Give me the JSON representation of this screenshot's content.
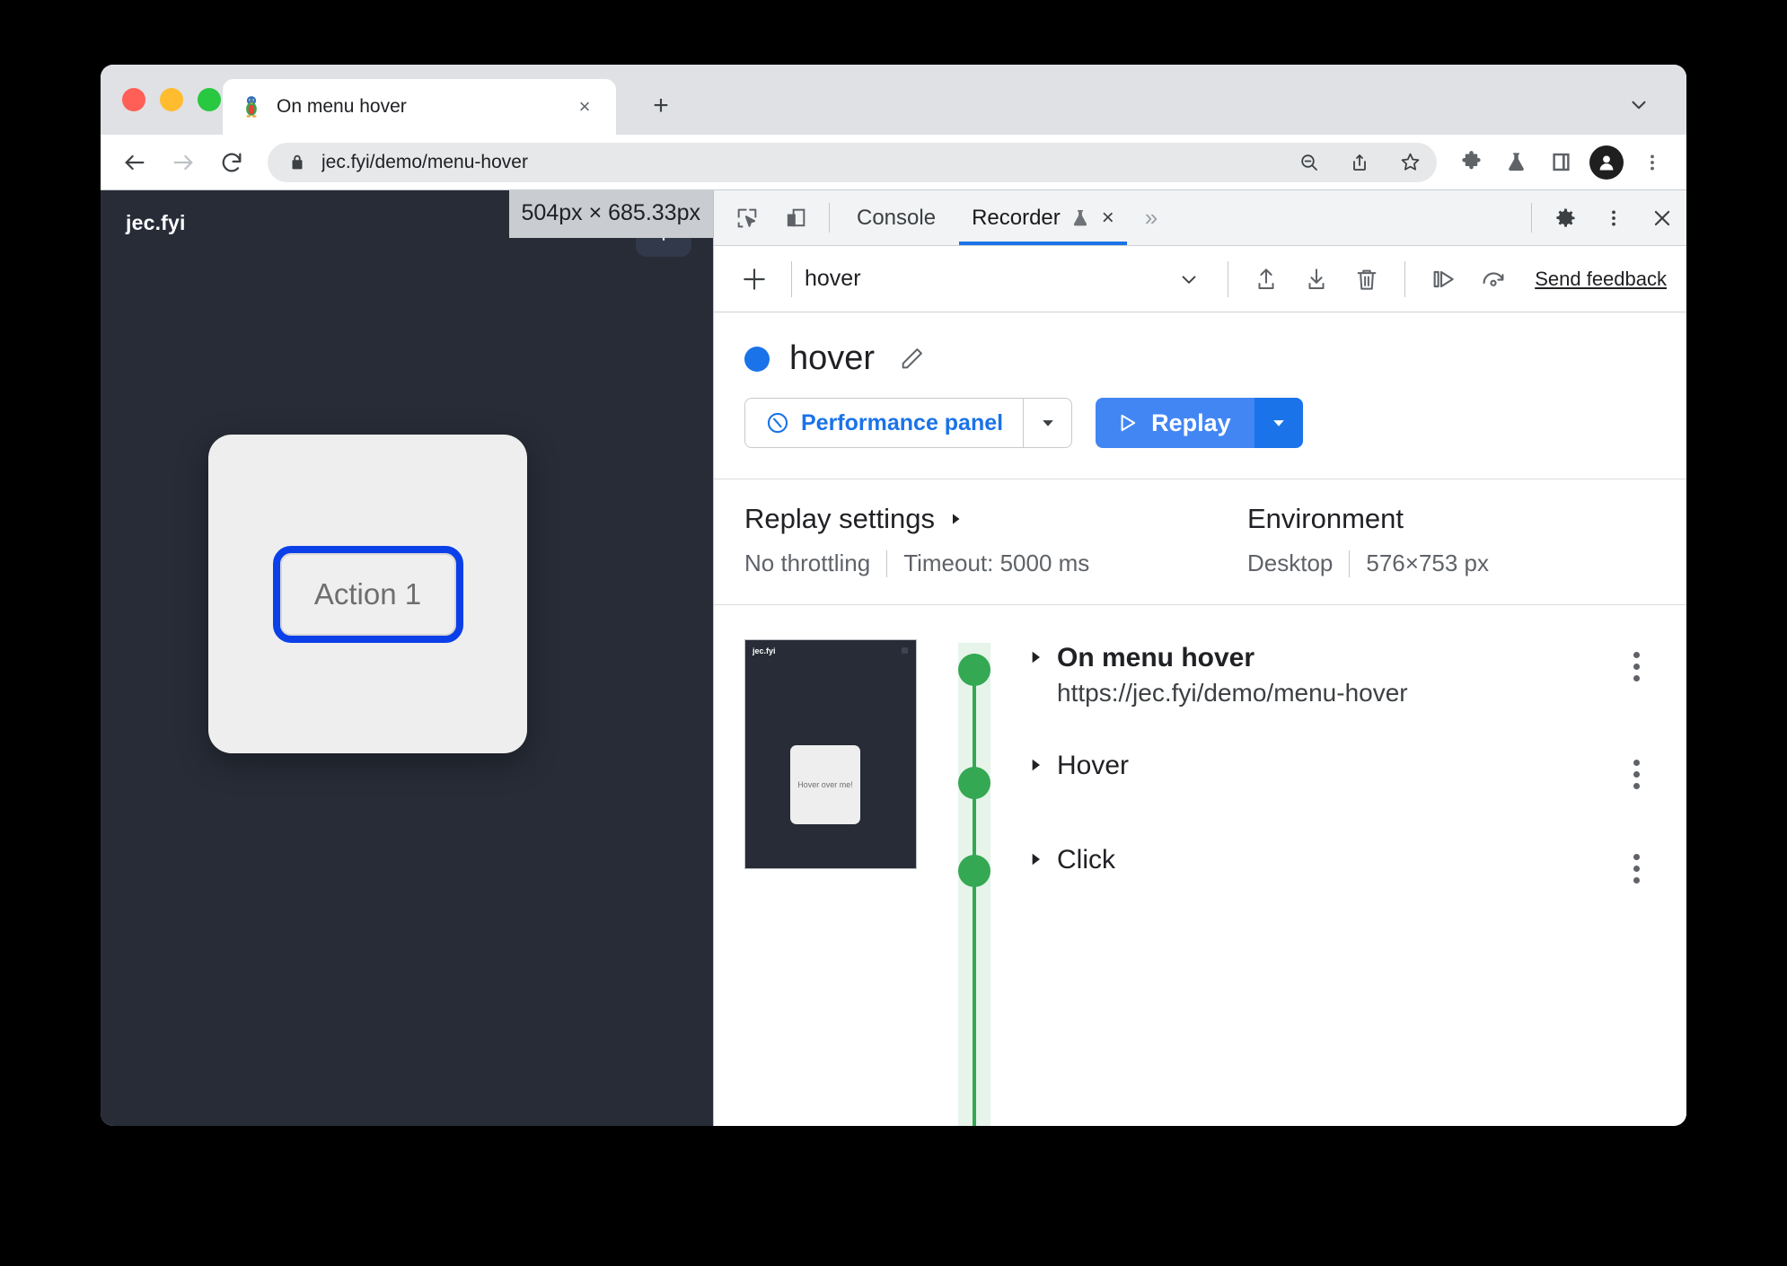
{
  "window": {
    "traffic_lights": [
      "close",
      "minimize",
      "maximize"
    ]
  },
  "browser": {
    "tab": {
      "title": "On menu hover",
      "favicon": "penguin-favicon",
      "close_label": "×"
    },
    "new_tab_label": "+",
    "tabstrip_chevron": "chevron-down-icon",
    "toolbar": {
      "back": "back-arrow-icon",
      "forward": "forward-arrow-icon",
      "reload": "reload-icon",
      "lock": "lock-icon",
      "url": "jec.fyi/demo/menu-hover",
      "zoom_out": "zoom-out-icon",
      "share": "share-icon",
      "bookmark": "star-icon",
      "extensions": "puzzle-icon",
      "labs": "flask-icon",
      "side_panel": "side-panel-icon",
      "profile": "profile-avatar-icon",
      "menu": "three-dot-menu-icon"
    }
  },
  "viewport": {
    "brand": "jec.fyi",
    "theme_toggle": "sun-icon",
    "size_tooltip": "504px × 685.33px",
    "action_button": "Action 1",
    "focus_outline_color": "#0b3fe8",
    "background_color": "#272c37"
  },
  "devtools": {
    "inspect_icon": "inspect-element-icon",
    "device_icon": "device-toolbar-icon",
    "tabs": [
      {
        "label": "Console",
        "active": false
      },
      {
        "label": "Recorder",
        "active": true,
        "experiment_icon": "flask-icon",
        "close": "×"
      }
    ],
    "more_tabs": "»",
    "settings_icon": "gear-icon",
    "kebab_icon": "three-dot-menu-icon",
    "close_icon": "close-icon",
    "accent_color": "#1a73e8"
  },
  "recorder_toolbar": {
    "add": "plus-icon",
    "selected_recording": "hover",
    "select_caret": "chevron-down-icon",
    "import": "import-icon",
    "export": "export-icon",
    "delete": "trash-icon",
    "step_over": "step-over-icon",
    "replay_speed": "replay-speed-icon",
    "feedback": "Send feedback"
  },
  "recording": {
    "bullet_color": "#1a73e8",
    "title": "hover",
    "edit_icon": "pencil-icon",
    "performance_button": {
      "label": "Performance panel",
      "icon": "performance-gauge-icon",
      "caret": "caret-down-icon"
    },
    "replay_button": {
      "label": "Replay",
      "icon": "play-triangle-icon",
      "caret": "caret-down-icon"
    }
  },
  "settings": {
    "replay": {
      "title": "Replay settings",
      "caret": "caret-right-icon",
      "throttling": "No throttling",
      "timeout": "Timeout: 5000 ms"
    },
    "environment": {
      "title": "Environment",
      "device": "Desktop",
      "viewport": "576×753 px"
    }
  },
  "thumbnail": {
    "brand": "jec.fyi",
    "card_text": "Hover over me!",
    "corner_icon": "sun-icon"
  },
  "steps": [
    {
      "caret": "caret-right-icon",
      "title": "On menu hover",
      "bold": true,
      "subtitle": "https://jec.fyi/demo/menu-hover",
      "menu": "three-dot-menu-icon",
      "marker_color": "#34a853"
    },
    {
      "caret": "caret-right-icon",
      "title": "Hover",
      "bold": false,
      "subtitle": "",
      "menu": "three-dot-menu-icon",
      "marker_color": "#34a853"
    },
    {
      "caret": "caret-right-icon",
      "title": "Click",
      "bold": false,
      "subtitle": "",
      "menu": "three-dot-menu-icon",
      "marker_color": "#34a853"
    }
  ]
}
